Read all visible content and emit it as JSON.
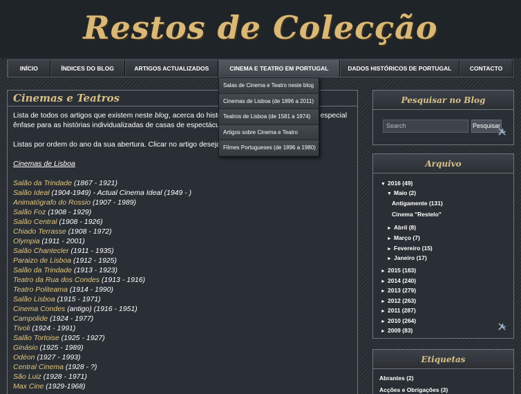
{
  "header": {
    "title": "Restos de Colecção"
  },
  "nav": {
    "items": [
      "INÍCIO",
      "ÍNDICES DO BLOG",
      "ARTIGOS ACTUALIZADOS",
      "CINEMA E TEATRO EM PORTUGAL",
      "DADOS HISTÓRICOS DE PORTUGAL",
      "CONTACTO"
    ],
    "dropdown": [
      "Salas de Cinema e Teatro neste blog",
      "Cinemas de Lisboa (de 1896 a 2011)",
      "Teatros de Lisboa (de 1581 a 1974)",
      "Artigos sobre Cinema e Teatro",
      "Filmes Portugueses (de 1896 a 1980)"
    ]
  },
  "main": {
    "title": "Cinemas e Teatros",
    "intro_line1_a": "Lista de todos os artigos que existem neste ",
    "intro_line1_blog": "blog",
    "intro_line1_b": ", acerca do história do",
    "intro_line1_c": "em especial",
    "intro_line2": "ênfase para as histórias individualizadas de casas de espectáculos, em Li",
    "order_text": "Listas por ordem do ano da sua abertura. Clicar no artigo desejado",
    "section": "Cinemas de Lisboa",
    "cinemas": [
      {
        "name": "Salão da Trindade",
        "years": " (1867 - 1921)"
      },
      {
        "name": "Salão Ideal",
        "years": " (1904-1949) - Actual Cinema Ideal (1949 - )"
      },
      {
        "name": "Animatógrafo do Rossio",
        "years": " (1907 - 1989)"
      },
      {
        "name": "Salão Foz",
        "years": " (1908 - 1929)"
      },
      {
        "name": "Salão Central",
        "years": " (1908 - 1926)"
      },
      {
        "name": "Chiado Terrasse",
        "years": " (1908 - 1972)"
      },
      {
        "name": "Olympia",
        "years": " (1911 - 2001)"
      },
      {
        "name": "Salão Chantecler",
        "years": " (1911 - 1935)"
      },
      {
        "name": "Paraizo de Lisboa",
        "years": " (1912 - 1925)"
      },
      {
        "name": "Salão da Trindade",
        "years": " (1913 - 1923)"
      },
      {
        "name": "Teatro da Rua dos Condes",
        "years": " (1913 - 1916)"
      },
      {
        "name": "Teatro Politeama",
        "years": " (1914 - 1990)"
      },
      {
        "name": "Salão Lisboa",
        "years": " (1915 - 1971)"
      },
      {
        "name": "Cinema Condes",
        "years": " (antigo) (1916 - 1951)"
      },
      {
        "name": "Campolide",
        "years": " (1924 - 1977)"
      },
      {
        "name": "Tivoli",
        "years": " (1924 - 1991)"
      },
      {
        "name": "Salão Tortoise",
        "years": " (1925 - 1927)"
      },
      {
        "name": "Ginásio",
        "years": " (1925 - 1989)"
      },
      {
        "name": "Odéon",
        "years": " (1927 - 1993)"
      },
      {
        "name": "Central Cinema",
        "years": " (1928 - ?)"
      },
      {
        "name": "São Luiz",
        "years": " (1928 - 1971)"
      },
      {
        "name": "Max Cine",
        "years": " (1929-1968)"
      }
    ]
  },
  "search": {
    "title": "Pesquisar no Blog",
    "placeholder": "Search",
    "button": "Pesquisar"
  },
  "archive": {
    "title": "Arquivo",
    "rows": [
      {
        "indent": 0,
        "open": true,
        "text": "2016 (49)"
      },
      {
        "indent": 1,
        "open": true,
        "text": "Maio (2)"
      },
      {
        "indent": 2,
        "open": null,
        "text": "Antigamente (131)"
      },
      {
        "indent": 2,
        "open": null,
        "text": "Cinema \"Restelo\""
      },
      {
        "indent": 1,
        "open": false,
        "text": "Abril (8)"
      },
      {
        "indent": 1,
        "open": false,
        "text": "Março (7)"
      },
      {
        "indent": 1,
        "open": false,
        "text": "Fevereiro (15)"
      },
      {
        "indent": 1,
        "open": false,
        "text": "Janeiro (17)"
      },
      {
        "indent": 0,
        "open": false,
        "text": "2015 (183)"
      },
      {
        "indent": 0,
        "open": false,
        "text": "2014 (240)"
      },
      {
        "indent": 0,
        "open": false,
        "text": "2013 (279)"
      },
      {
        "indent": 0,
        "open": false,
        "text": "2012 (263)"
      },
      {
        "indent": 0,
        "open": false,
        "text": "2011 (287)"
      },
      {
        "indent": 0,
        "open": false,
        "text": "2010 (264)"
      },
      {
        "indent": 0,
        "open": false,
        "text": "2009 (83)"
      }
    ]
  },
  "labels": {
    "title": "Etiquetas",
    "items": [
      "Abrantes (2)",
      "Acções e Obrigações (3)"
    ]
  },
  "colors": {
    "gold": "#d8c089",
    "link": "#e3c67f",
    "panel": "#2a2f35"
  }
}
